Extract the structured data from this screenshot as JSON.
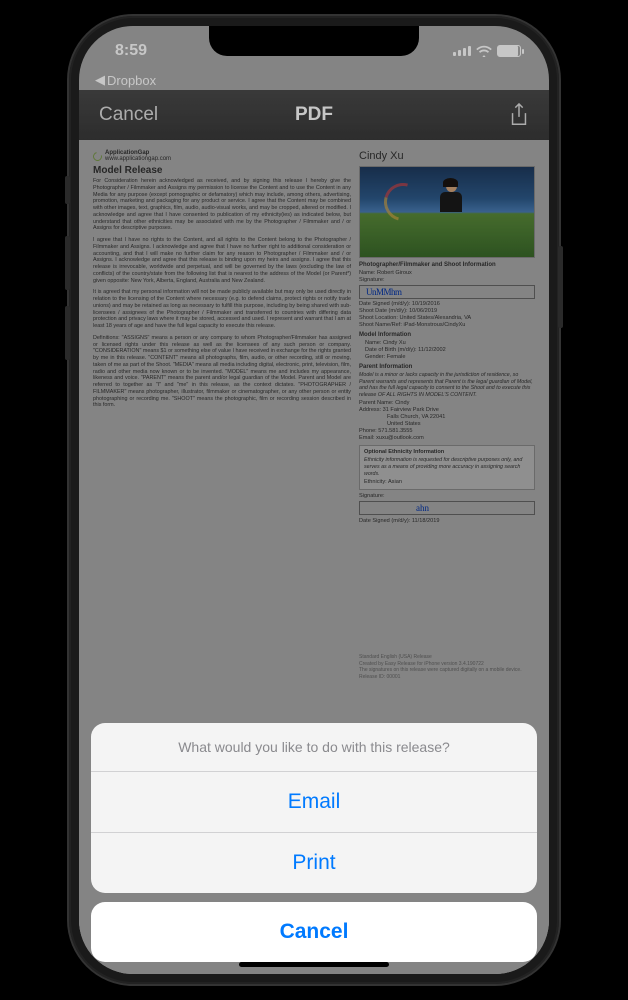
{
  "status": {
    "time": "8:59"
  },
  "back": {
    "label": "Dropbox"
  },
  "nav": {
    "cancel": "Cancel",
    "title": "PDF"
  },
  "doc": {
    "app_name": "ApplicationGap",
    "app_url": "www.applicationgap.com",
    "title": "Model Release",
    "p1": "For Consideration herein acknowledged as received, and by signing this release I hereby give the Photographer / Filmmaker and Assigns my permission to license the Content and to use the Content in any Media for any purpose (except pornographic or defamatory) which may include, among others, advertising, promotion, marketing and packaging for any product or service. I agree that the Content may be combined with other images, text, graphics, film, audio, audio-visual works, and may be cropped, altered or modified. I acknowledge and agree that I have consented to publication of my ethnicity(ies) as indicated below, but understand that other ethnicities may be associated with me by the Photographer / Filmmaker and / or Assigns for descriptive purposes.",
    "p2": "I agree that I have no rights to the Content, and all rights to the Content belong to the Photographer / Filmmaker and Assigns. I acknowledge and agree that I have no further right to additional consideration or accounting, and that I will make no further claim for any reason to Photographer / Filmmaker and / or Assigns. I acknowledge and agree that this release is binding upon my heirs and assigns. I agree that this release is irrevocable, worldwide and perpetual, and will be governed by the laws (excluding the law of conflicts) of the country/state from the following list that is nearest to the address of the Model (or Parent*) given opposite: New York, Alberta, England, Australia and New Zealand.",
    "p3": "It is agreed that my personal information will not be made publicly available but may only be used directly in relation to the licensing of the Content where necessary (e.g. to defend claims, protect rights or notify trade unions) and may be retained as long as necessary to fulfill this purpose, including by being shared with sub-licensees / assignees of the Photographer / Filmmaker and transferred to countries with differing data protection and privacy laws where it may be stored, accessed and used. I represent and warrant that I am at least 18 years of age and have the full legal capacity to execute this release.",
    "p4": "Definitions: \"ASSIGNS\" means a person or any company to whom Photographer/Filmmaker has assigned or licensed rights under this release as well as the licensees of any such person or company. \"CONSIDERATION\" means $1 or something else of value I have received in exchange for the rights granted by me in this release. \"CONTENT\" means all photographs, film, audio, or other recording, still or moving, taken of me as part of the Shoot. \"MEDIA\" means all media including digital, electronic, print, television, film, radio and other media now known or to be invented. \"MODEL\" means me and includes my appearance, likeness and voice. \"PARENT\" means the parent and/or legal guardian of the Model. Parent and Model are referred to together as \"I\" and \"me\" in this release, as the context dictates. \"PHOTOGRAPHER / FILMMAKER\" means photographer, illustrator, filmmaker or cinematographer, or any other person or entity photographing or recording me. \"SHOOT\" means the photographic, film or recording session described in this form.",
    "model_name": "Cindy Xu",
    "sect_shoot": "Photographer/Filmmaker and Shoot Information",
    "photog_name_lbl": "Name: ",
    "photog_name": "Robert Giroux",
    "sig_lbl": "Signature:",
    "date_signed1_lbl": "Date Signed (m/d/y): ",
    "date_signed1": "10/19/2016",
    "shoot_date_lbl": "Shoot Date (m/d/y): ",
    "shoot_date": "10/06/2019",
    "shoot_loc_lbl": "Shoot Location: ",
    "shoot_loc": "United States/Alexandria, VA",
    "shoot_ref_lbl": "Shoot Name/Ref: ",
    "shoot_ref": "iPad-Monstrous/CindyXu",
    "sect_model": "Model Information",
    "m_name_lbl": "Name: ",
    "m_name": "Cindy Xu",
    "m_dob_lbl": "Date of Birth (m/d/y): ",
    "m_dob": "11/12/2002",
    "m_gender_lbl": "Gender: ",
    "m_gender": "Female",
    "sect_parent": "Parent Information",
    "parent_blurb": "Model is a minor or lacks capacity in the jurisdiction of residence, so Parent warrants and represents that Parent is the legal guardian of Model, and has the full legal capacity to consent to the Shoot and to execute this release OF ALL RIGHTS IN MODEL'S CONTENT.",
    "pr_name_lbl": "Parent Name: ",
    "pr_name": "Cindy",
    "pr_addr_lbl": "Address: ",
    "pr_addr1": "31 Fairview Park Drive",
    "pr_addr2": "Falls Church, VA 22041",
    "pr_addr3": "United States",
    "pr_phone_lbl": "Phone: ",
    "pr_phone": "571.581.3555",
    "pr_email_lbl": "Email: ",
    "pr_email": "xuxu@outlook.com",
    "ethn_head": "Optional Ethnicity Information",
    "ethn_blurb": "Ethnicity information is requested for descriptive purposes only, and serves as a means of providing more accuracy in assigning search words.",
    "ethn_lbl": "Ethnicity: ",
    "ethn_val": "Asian",
    "date_signed2_lbl": "Date Signed (m/d/y): ",
    "date_signed2": "11/18/2019",
    "foot1": "Standard English (USA) Release",
    "foot2": "Created by Easy Release for iPhone version 3.4.190722",
    "foot3": "The signatures on this release were captured digitally on a mobile device.",
    "foot4": "Release ID: 00001"
  },
  "sheet": {
    "title": "What would you like to do with this release?",
    "email": "Email",
    "print": "Print",
    "cancel": "Cancel"
  }
}
